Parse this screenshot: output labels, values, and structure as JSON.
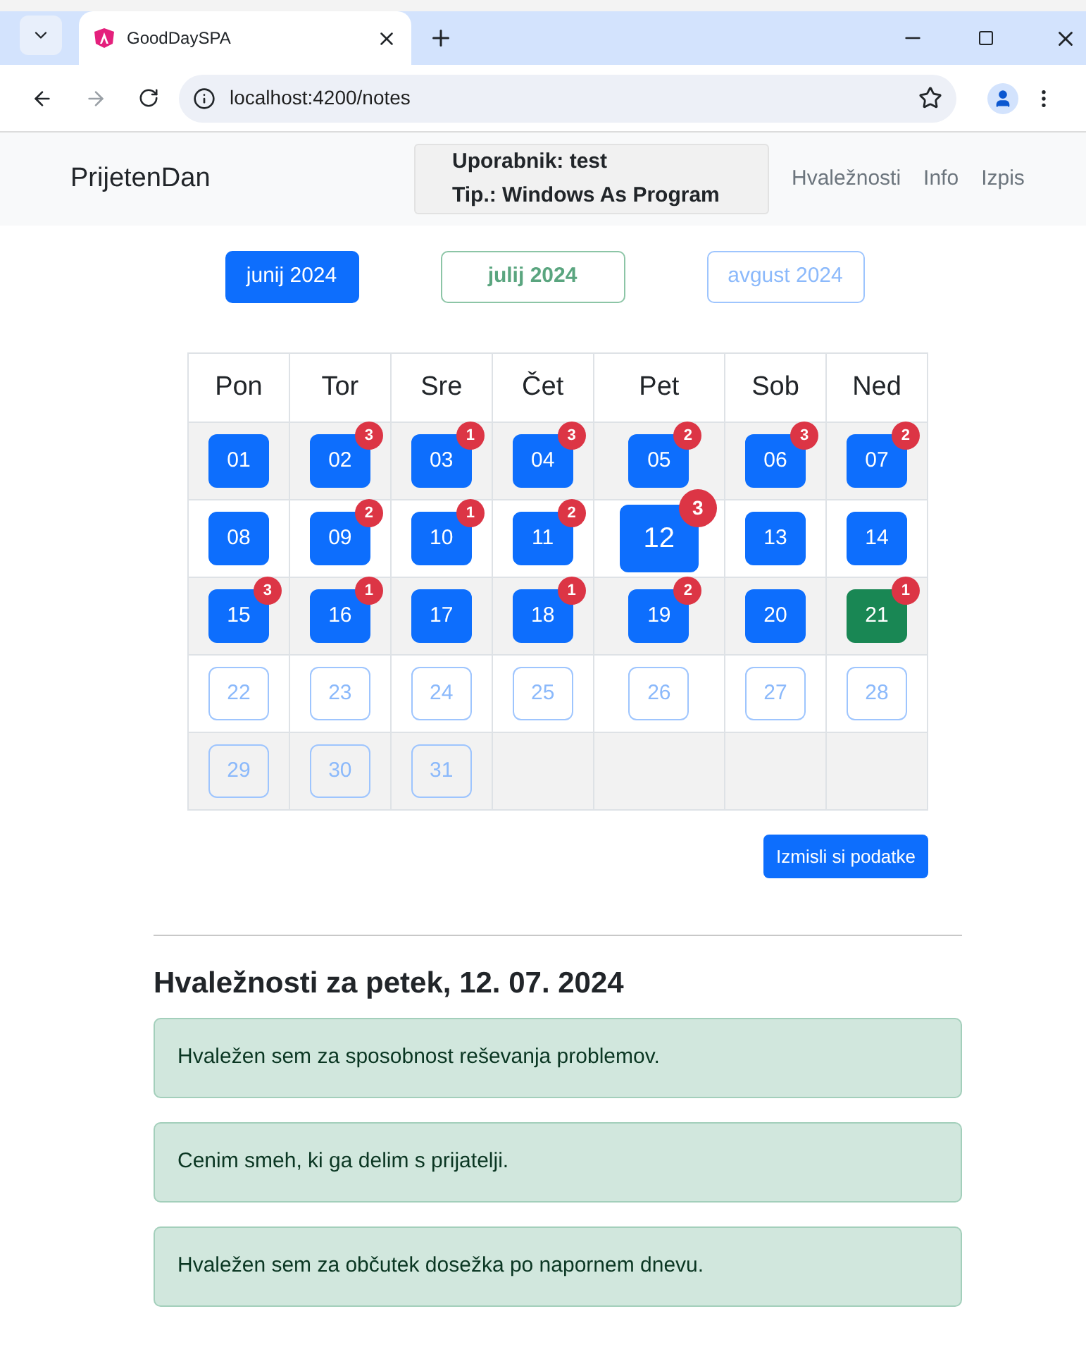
{
  "browser": {
    "tab_title": "GoodDaySPA",
    "url": "localhost:4200/notes"
  },
  "navbar": {
    "brand": "PrijetenDan",
    "user_lines": [
      "Uporabnik: test",
      "Tip.: Windows As Program"
    ],
    "links": [
      "Hvaležnosti",
      "Info",
      "Izpis"
    ]
  },
  "months": [
    {
      "label": "junij 2024",
      "kind": "prev"
    },
    {
      "label": "julij 2024",
      "kind": "current"
    },
    {
      "label": "avgust 2024",
      "kind": "next"
    }
  ],
  "calendar": {
    "weekdays": [
      "Pon",
      "Tor",
      "Sre",
      "Čet",
      "Pet",
      "Sob",
      "Ned"
    ],
    "weeks": [
      [
        {
          "label": "01",
          "kind": "past",
          "selected": false
        },
        {
          "label": "02",
          "kind": "past",
          "selected": false,
          "badge": "3"
        },
        {
          "label": "03",
          "kind": "past",
          "selected": false,
          "badge": "1"
        },
        {
          "label": "04",
          "kind": "past",
          "selected": false,
          "badge": "3"
        },
        {
          "label": "05",
          "kind": "past",
          "selected": false,
          "badge": "2"
        },
        {
          "label": "06",
          "kind": "past",
          "selected": false,
          "badge": "3"
        },
        {
          "label": "07",
          "kind": "past",
          "selected": false,
          "badge": "2"
        }
      ],
      [
        {
          "label": "08",
          "kind": "past",
          "selected": false
        },
        {
          "label": "09",
          "kind": "past",
          "selected": false,
          "badge": "2"
        },
        {
          "label": "10",
          "kind": "past",
          "selected": false,
          "badge": "1"
        },
        {
          "label": "11",
          "kind": "past",
          "selected": false,
          "badge": "2"
        },
        {
          "label": "12",
          "kind": "past",
          "selected": true,
          "badge": "3"
        },
        {
          "label": "13",
          "kind": "past",
          "selected": false
        },
        {
          "label": "14",
          "kind": "past",
          "selected": false
        }
      ],
      [
        {
          "label": "15",
          "kind": "past",
          "selected": false,
          "badge": "3"
        },
        {
          "label": "16",
          "kind": "past",
          "selected": false,
          "badge": "1"
        },
        {
          "label": "17",
          "kind": "past",
          "selected": false
        },
        {
          "label": "18",
          "kind": "past",
          "selected": false,
          "badge": "1"
        },
        {
          "label": "19",
          "kind": "past",
          "selected": false,
          "badge": "2"
        },
        {
          "label": "20",
          "kind": "past",
          "selected": false
        },
        {
          "label": "21",
          "kind": "today",
          "selected": false,
          "badge": "1"
        }
      ],
      [
        {
          "label": "22",
          "kind": "future",
          "selected": false
        },
        {
          "label": "23",
          "kind": "future",
          "selected": false
        },
        {
          "label": "24",
          "kind": "future",
          "selected": false
        },
        {
          "label": "25",
          "kind": "future",
          "selected": false
        },
        {
          "label": "26",
          "kind": "future",
          "selected": false
        },
        {
          "label": "27",
          "kind": "future",
          "selected": false
        },
        {
          "label": "28",
          "kind": "future",
          "selected": false
        }
      ],
      [
        {
          "label": "29",
          "kind": "future",
          "selected": false
        },
        {
          "label": "30",
          "kind": "future",
          "selected": false
        },
        {
          "label": "31",
          "kind": "future",
          "selected": false
        }
      ]
    ]
  },
  "generate_button": "Izmisli si podatke",
  "notes_heading": "Hvaležnosti za petek, 12. 07. 2024",
  "notes": [
    "Hvaležen sem za sposobnost reševanja problemov.",
    "Cenim smeh, ki ga delim s prijatelji.",
    "Hvaležen sem za občutek dosežka po napornem dnevu."
  ]
}
